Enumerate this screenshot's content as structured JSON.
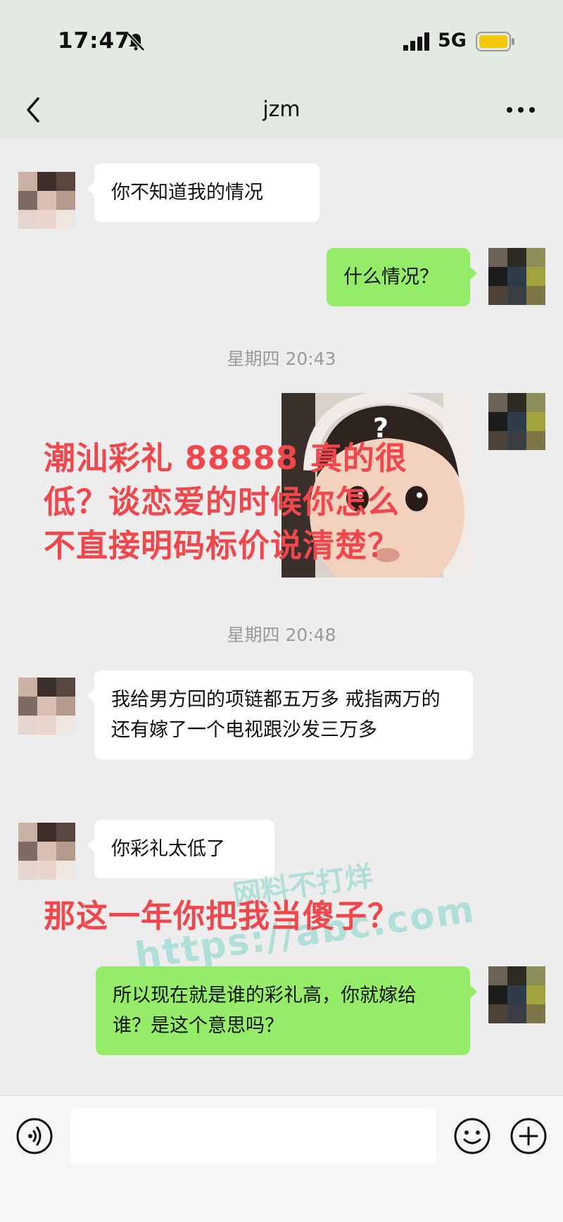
{
  "status": {
    "time": "17:47",
    "network": "5G"
  },
  "header": {
    "title": "jzm"
  },
  "messages": [
    {
      "side": "left",
      "text": "你不知道我的情况"
    },
    {
      "side": "right",
      "text": "什么情况？"
    },
    {
      "side": "left",
      "text": "我给男方回的项链都五万多 戒指两万的 还有嫁了一个电视跟沙发三万多"
    },
    {
      "side": "left",
      "text": "你彩礼太低了"
    },
    {
      "side": "right",
      "text": "所以现在就是谁的彩礼高，你就嫁给谁？是这个意思吗？"
    }
  ],
  "timestamps": [
    "星期四 20:43",
    "星期四 20:48"
  ],
  "overlay": {
    "line1": "潮汕彩礼 88888 真的很",
    "line2": "低？谈恋爱的时候你怎么",
    "line3": "不直接明码标价说清楚？",
    "line4": "那这一年你把我当傻子？"
  },
  "photo": {
    "mark": "?"
  },
  "watermark": {
    "line1": "网料不打烊",
    "line2": "https://abc.com"
  },
  "colors": {
    "overlay": "#f0474c",
    "bubble_right": "#95ec69",
    "bubble_left": "#ffffff",
    "header_bg": "#e3eae1"
  },
  "icons": [
    "mute-bell-icon",
    "signal-icon",
    "battery-icon",
    "back-icon",
    "more-icon",
    "voice-icon",
    "emoji-icon",
    "plus-icon"
  ]
}
